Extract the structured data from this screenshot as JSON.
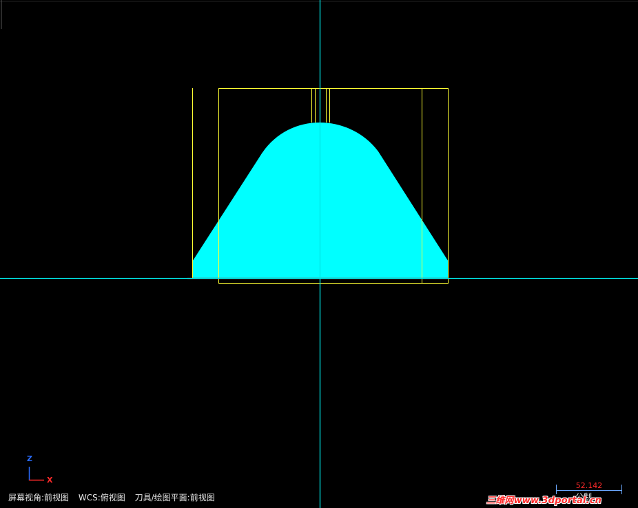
{
  "status_bar": {
    "screen_view": "屏幕视角:前视图",
    "wcs": "WCS:俯视图",
    "tool_plane": "刀具/绘图平面:前视图"
  },
  "axis_indicator": {
    "z_label": "Z",
    "x_label": "X"
  },
  "scale_bar": {
    "value": "52.142",
    "unit": "公制"
  },
  "watermark": "三维网www.3dportal.cn",
  "colors": {
    "background": "#000000",
    "part_fill": "#00ffff",
    "crosshair": "#00e5e5",
    "boundary_lines": "#ffff33",
    "axis_z": "#2a6cff",
    "axis_x": "#ff2a2a",
    "scale_bar": "#6aa7ff",
    "scale_text": "#ff2a2a"
  }
}
